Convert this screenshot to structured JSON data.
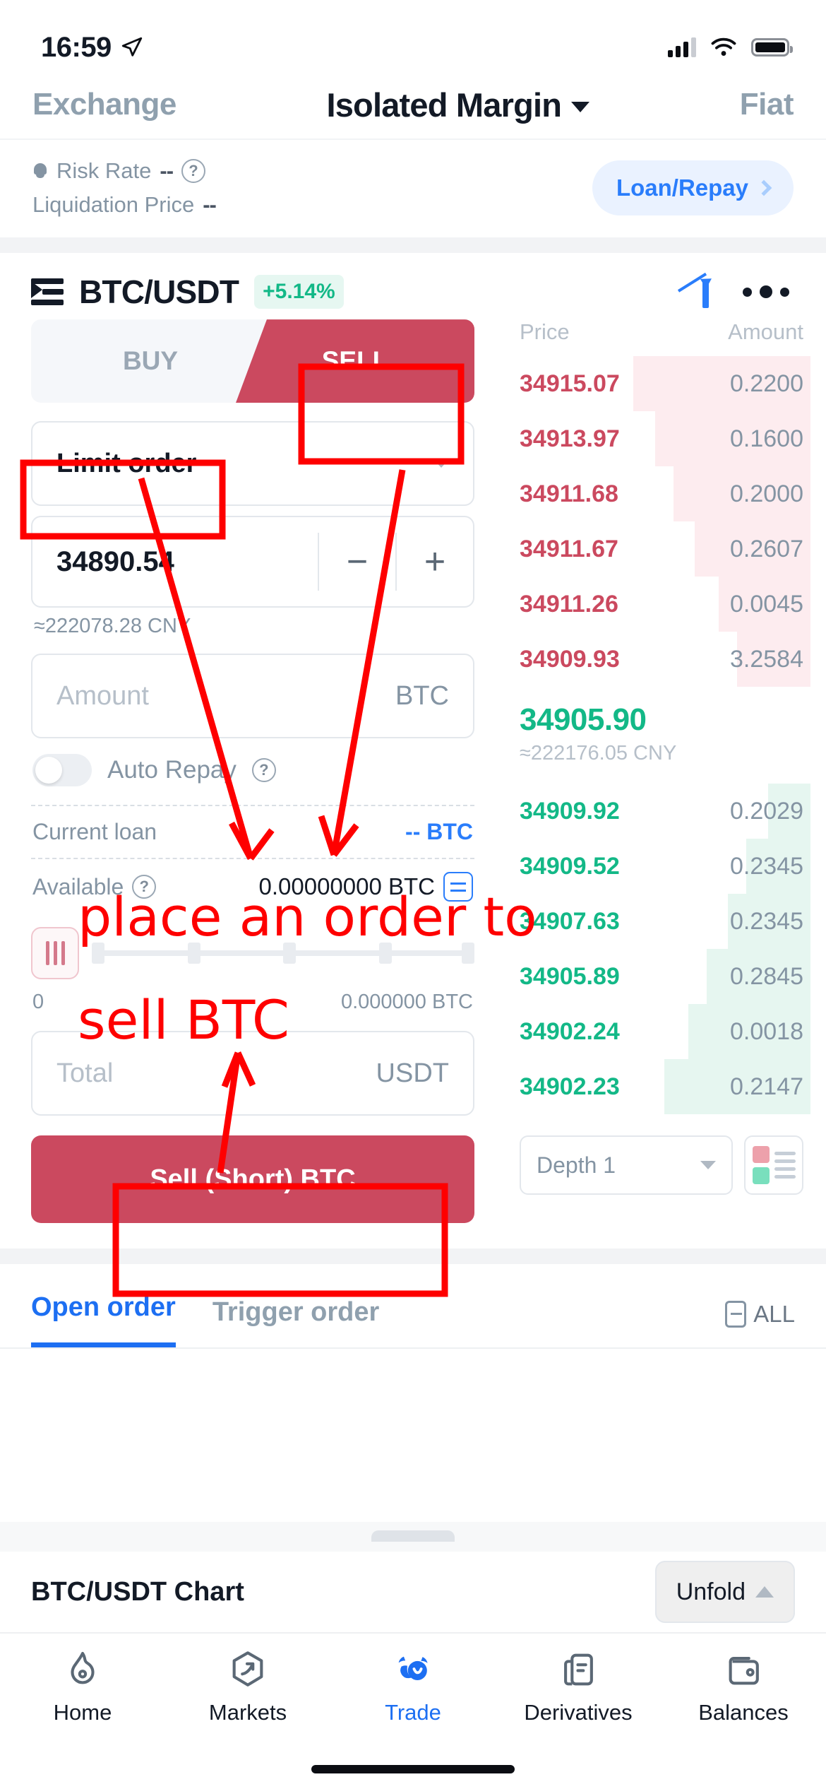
{
  "status_bar": {
    "time": "16:59",
    "location_icon": "location-arrow-icon"
  },
  "top_tabs": {
    "left": "Exchange",
    "center": "Isolated Margin",
    "right": "Fiat"
  },
  "risk_bar": {
    "risk_rate_label": "Risk Rate",
    "risk_rate_value": "--",
    "liquidation_label": "Liquidation Price",
    "liquidation_value": "--",
    "loan_repay": "Loan/Repay"
  },
  "pair": {
    "symbol": "BTC/USDT",
    "change": "+5.14%",
    "change_color": "#13b887"
  },
  "order_form": {
    "buy_tab": "BUY",
    "sell_tab": "SELL",
    "sell_tab_active": true,
    "order_type": "Limit order",
    "price_value": "34890.54",
    "price_minus": "−",
    "price_plus": "+",
    "price_cny": "≈222078.28 CNY",
    "amount_placeholder": "Amount",
    "amount_unit": "BTC",
    "auto_repay_label": "Auto Repay",
    "auto_repay_on": false,
    "current_loan_label": "Current loan",
    "current_loan_value": "-- BTC",
    "available_label": "Available",
    "available_value": "0.00000000 BTC",
    "slider_min": "0",
    "slider_max": "0.000000 BTC",
    "total_placeholder": "Total",
    "total_unit": "USDT",
    "submit_label": "Sell (Short) BTC",
    "submit_color": "#cb495f"
  },
  "order_book": {
    "col_price": "Price",
    "col_amount": "Amount",
    "asks": [
      {
        "price": "34915.07",
        "amount": "0.2200",
        "depth": 58
      },
      {
        "price": "34913.97",
        "amount": "0.1600",
        "depth": 51
      },
      {
        "price": "34911.68",
        "amount": "0.2000",
        "depth": 45
      },
      {
        "price": "34911.67",
        "amount": "0.2607",
        "depth": 38
      },
      {
        "price": "34911.26",
        "amount": "0.0045",
        "depth": 30
      },
      {
        "price": "34909.93",
        "amount": "3.2584",
        "depth": 24
      }
    ],
    "last_price": "34905.90",
    "last_price_cny": "≈222176.05 CNY",
    "bids": [
      {
        "price": "34909.92",
        "amount": "0.2029",
        "depth": 14
      },
      {
        "price": "34909.52",
        "amount": "0.2345",
        "depth": 21
      },
      {
        "price": "34907.63",
        "amount": "0.2345",
        "depth": 27
      },
      {
        "price": "34905.89",
        "amount": "0.2845",
        "depth": 34
      },
      {
        "price": "34902.24",
        "amount": "0.0018",
        "depth": 40
      },
      {
        "price": "34902.23",
        "amount": "0.2147",
        "depth": 48
      }
    ],
    "depth_select": "Depth 1",
    "mode_icon": "orderbook-mode-icon"
  },
  "order_tabs": {
    "open_order": "Open order",
    "trigger_order": "Trigger order",
    "all": "ALL"
  },
  "chart_footer": {
    "title": "BTC/USDT Chart",
    "unfold": "Unfold"
  },
  "bottom_nav": {
    "items": [
      {
        "label": "Home",
        "icon": "flame-icon",
        "active": false
      },
      {
        "label": "Markets",
        "icon": "markets-icon",
        "active": false
      },
      {
        "label": "Trade",
        "icon": "trade-icon",
        "active": true
      },
      {
        "label": "Derivatives",
        "icon": "document-icon",
        "active": false
      },
      {
        "label": "Balances",
        "icon": "wallet-icon",
        "active": false
      }
    ]
  },
  "annotation": {
    "line1": "place an order to",
    "line2": "sell BTC",
    "color": "#fe0000"
  }
}
